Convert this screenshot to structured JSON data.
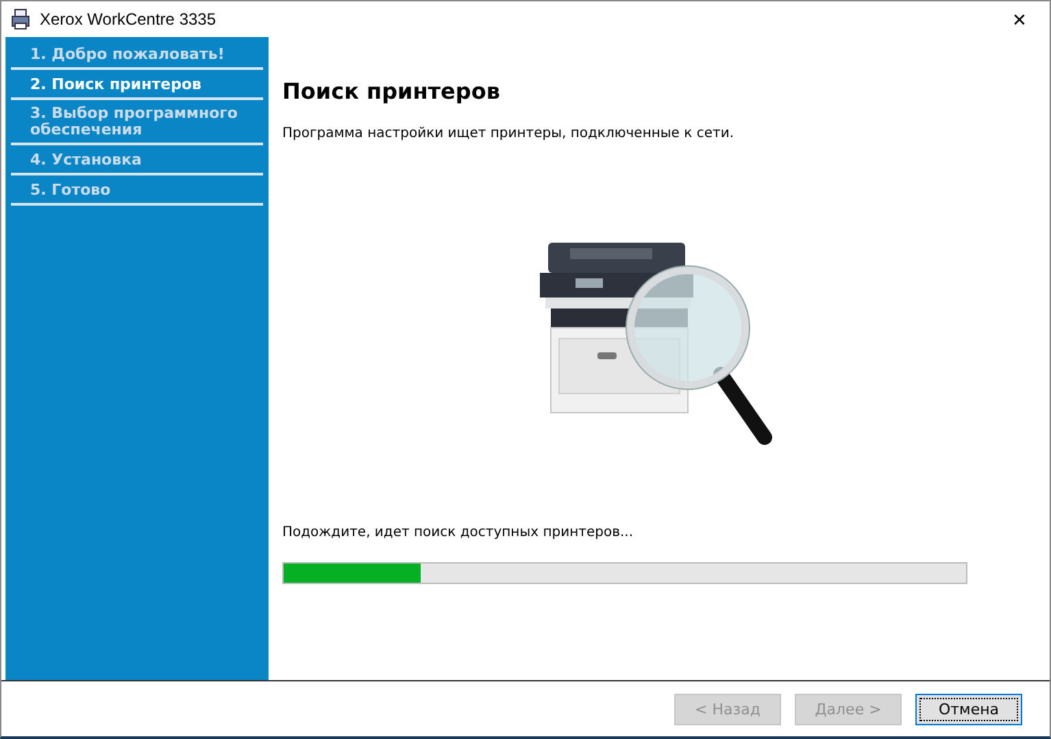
{
  "window": {
    "title": "Xerox WorkCentre 3335",
    "close": "✕"
  },
  "steps": [
    {
      "label": "1. Добро пожаловать!",
      "selected": false
    },
    {
      "label": "2. Поиск принтеров",
      "selected": true
    },
    {
      "label": "3. Выбор программного обеспечения",
      "selected": false
    },
    {
      "label": "4. Установка",
      "selected": false
    },
    {
      "label": "5. Готово",
      "selected": false
    }
  ],
  "page": {
    "heading": "Поиск принтеров",
    "description": "Программа настройки ищет принтеры, подключенные к сети.",
    "status": "Подождите, идет поиск доступных принтеров...",
    "progress": {
      "level": 0.2
    }
  },
  "buttons": [
    {
      "label": "< Назад",
      "disabled": true
    },
    {
      "label": "Далее >",
      "disabled": true
    },
    {
      "label": "Отмена",
      "disabled": false
    }
  ]
}
